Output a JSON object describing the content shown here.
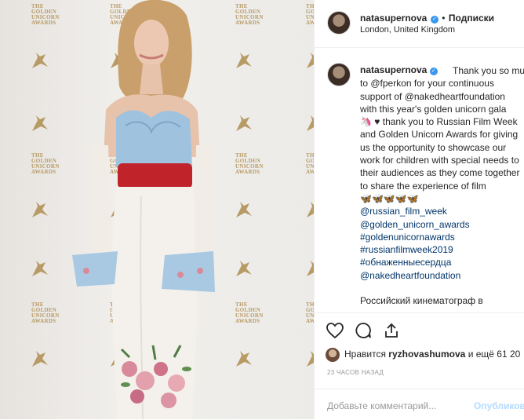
{
  "post": {
    "username": "natasupernova",
    "separator": "•",
    "follow_label": "Подписки",
    "location": "London, United Kingdom",
    "caption_lines": [
      "Thank you so much",
      "to @fperkon for your continuous",
      "support of @nakedheartfoundation",
      "with this year's golden unicorn gala",
      "🦄 ♥ thank you to Russian Film Week",
      "and Golden Unicorn Awards for giving",
      "us the opportunity to showcase our",
      "work for children with special needs to",
      "their audiences as they come together",
      "to share the experience of film",
      "🦋🦋🦋🦋🦋",
      "@russian_film_week",
      "@golden_unicorn_awards",
      "#goldenunicornawards",
      "#russianfilmweek2019",
      "#обнаженныесердца",
      "@nakedheartfoundation",
      "",
      "Российский кинематограф в"
    ],
    "likes_prefix": "Нравится",
    "likes_user": "ryzhovashumova",
    "likes_suffix": "и ещё 61 20",
    "time_ago": "23 ЧАСОВ НАЗАД",
    "comment_placeholder": "Добавьте комментарий...",
    "post_button": "Опубликовать"
  },
  "photo": {
    "logo_lines": [
      "THE",
      "GOLDEN",
      "UNICORN",
      "AWARDS"
    ]
  },
  "icons": {
    "verified": "verified-badge-icon",
    "like": "heart-icon",
    "comment": "comment-icon",
    "share": "share-icon"
  },
  "colors": {
    "accent": "#3897f0",
    "gold": "#b79a64",
    "post_disabled": "#b3dbff"
  }
}
